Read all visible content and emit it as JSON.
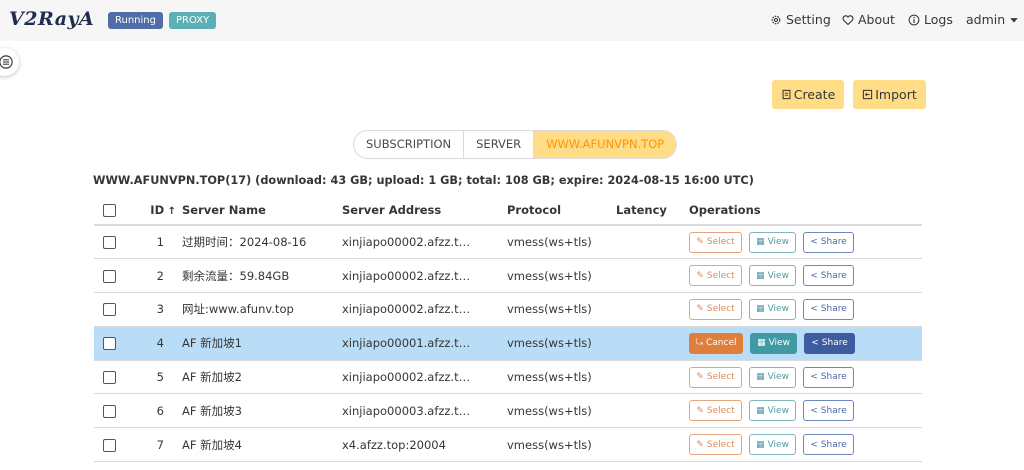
{
  "app": {
    "logo": "V2RayA",
    "status_running": "Running",
    "status_proxy": "PROXY"
  },
  "nav": {
    "setting": "Setting",
    "about": "About",
    "logs": "Logs",
    "user": "admin"
  },
  "actions": {
    "create": "Create",
    "import": "Import"
  },
  "tabs": [
    "SUBSCRIPTION",
    "SERVER",
    "WWW.AFUNVPN.TOP"
  ],
  "active_tab": "WWW.AFUNVPN.TOP",
  "summary": "WWW.AFUNVPN.TOP(17) (download: 43 GB; upload: 1 GB; total: 108 GB; expire: 2024-08-15 16:00 UTC)",
  "table": {
    "headers": {
      "id": "ID",
      "name": "Server Name",
      "address": "Server Address",
      "protocol": "Protocol",
      "latency": "Latency",
      "operations": "Operations"
    },
    "rows": [
      {
        "id": "1",
        "name": "过期时间：2024-08-16",
        "address": "xinjiapo00002.afzz.t…",
        "protocol": "vmess(ws+tls)",
        "latency": "",
        "selected": false
      },
      {
        "id": "2",
        "name": "剩余流量：59.84GB",
        "address": "xinjiapo00002.afzz.t…",
        "protocol": "vmess(ws+tls)",
        "latency": "",
        "selected": false
      },
      {
        "id": "3",
        "name": "网址:www.afunv.top",
        "address": "xinjiapo00002.afzz.t…",
        "protocol": "vmess(ws+tls)",
        "latency": "",
        "selected": false
      },
      {
        "id": "4",
        "name": "AF 新加坡1",
        "address": "xinjiapo00001.afzz.t…",
        "protocol": "vmess(ws+tls)",
        "latency": "",
        "selected": true
      },
      {
        "id": "5",
        "name": "AF 新加坡2",
        "address": "xinjiapo00002.afzz.t…",
        "protocol": "vmess(ws+tls)",
        "latency": "",
        "selected": false
      },
      {
        "id": "6",
        "name": "AF 新加坡3",
        "address": "xinjiapo00003.afzz.t…",
        "protocol": "vmess(ws+tls)",
        "latency": "",
        "selected": false
      },
      {
        "id": "7",
        "name": "AF 新加坡4",
        "address": "x4.afzz.top:20004",
        "protocol": "vmess(ws+tls)",
        "latency": "",
        "selected": false
      }
    ],
    "op_labels": {
      "select": "Select",
      "cancel": "Cancel",
      "view": "View",
      "share": "Share"
    }
  },
  "colors": {
    "accent": "#ffdd86",
    "running": "#506da8",
    "proxy": "#5bb0b6",
    "selected_row": "#b9dcf7"
  }
}
